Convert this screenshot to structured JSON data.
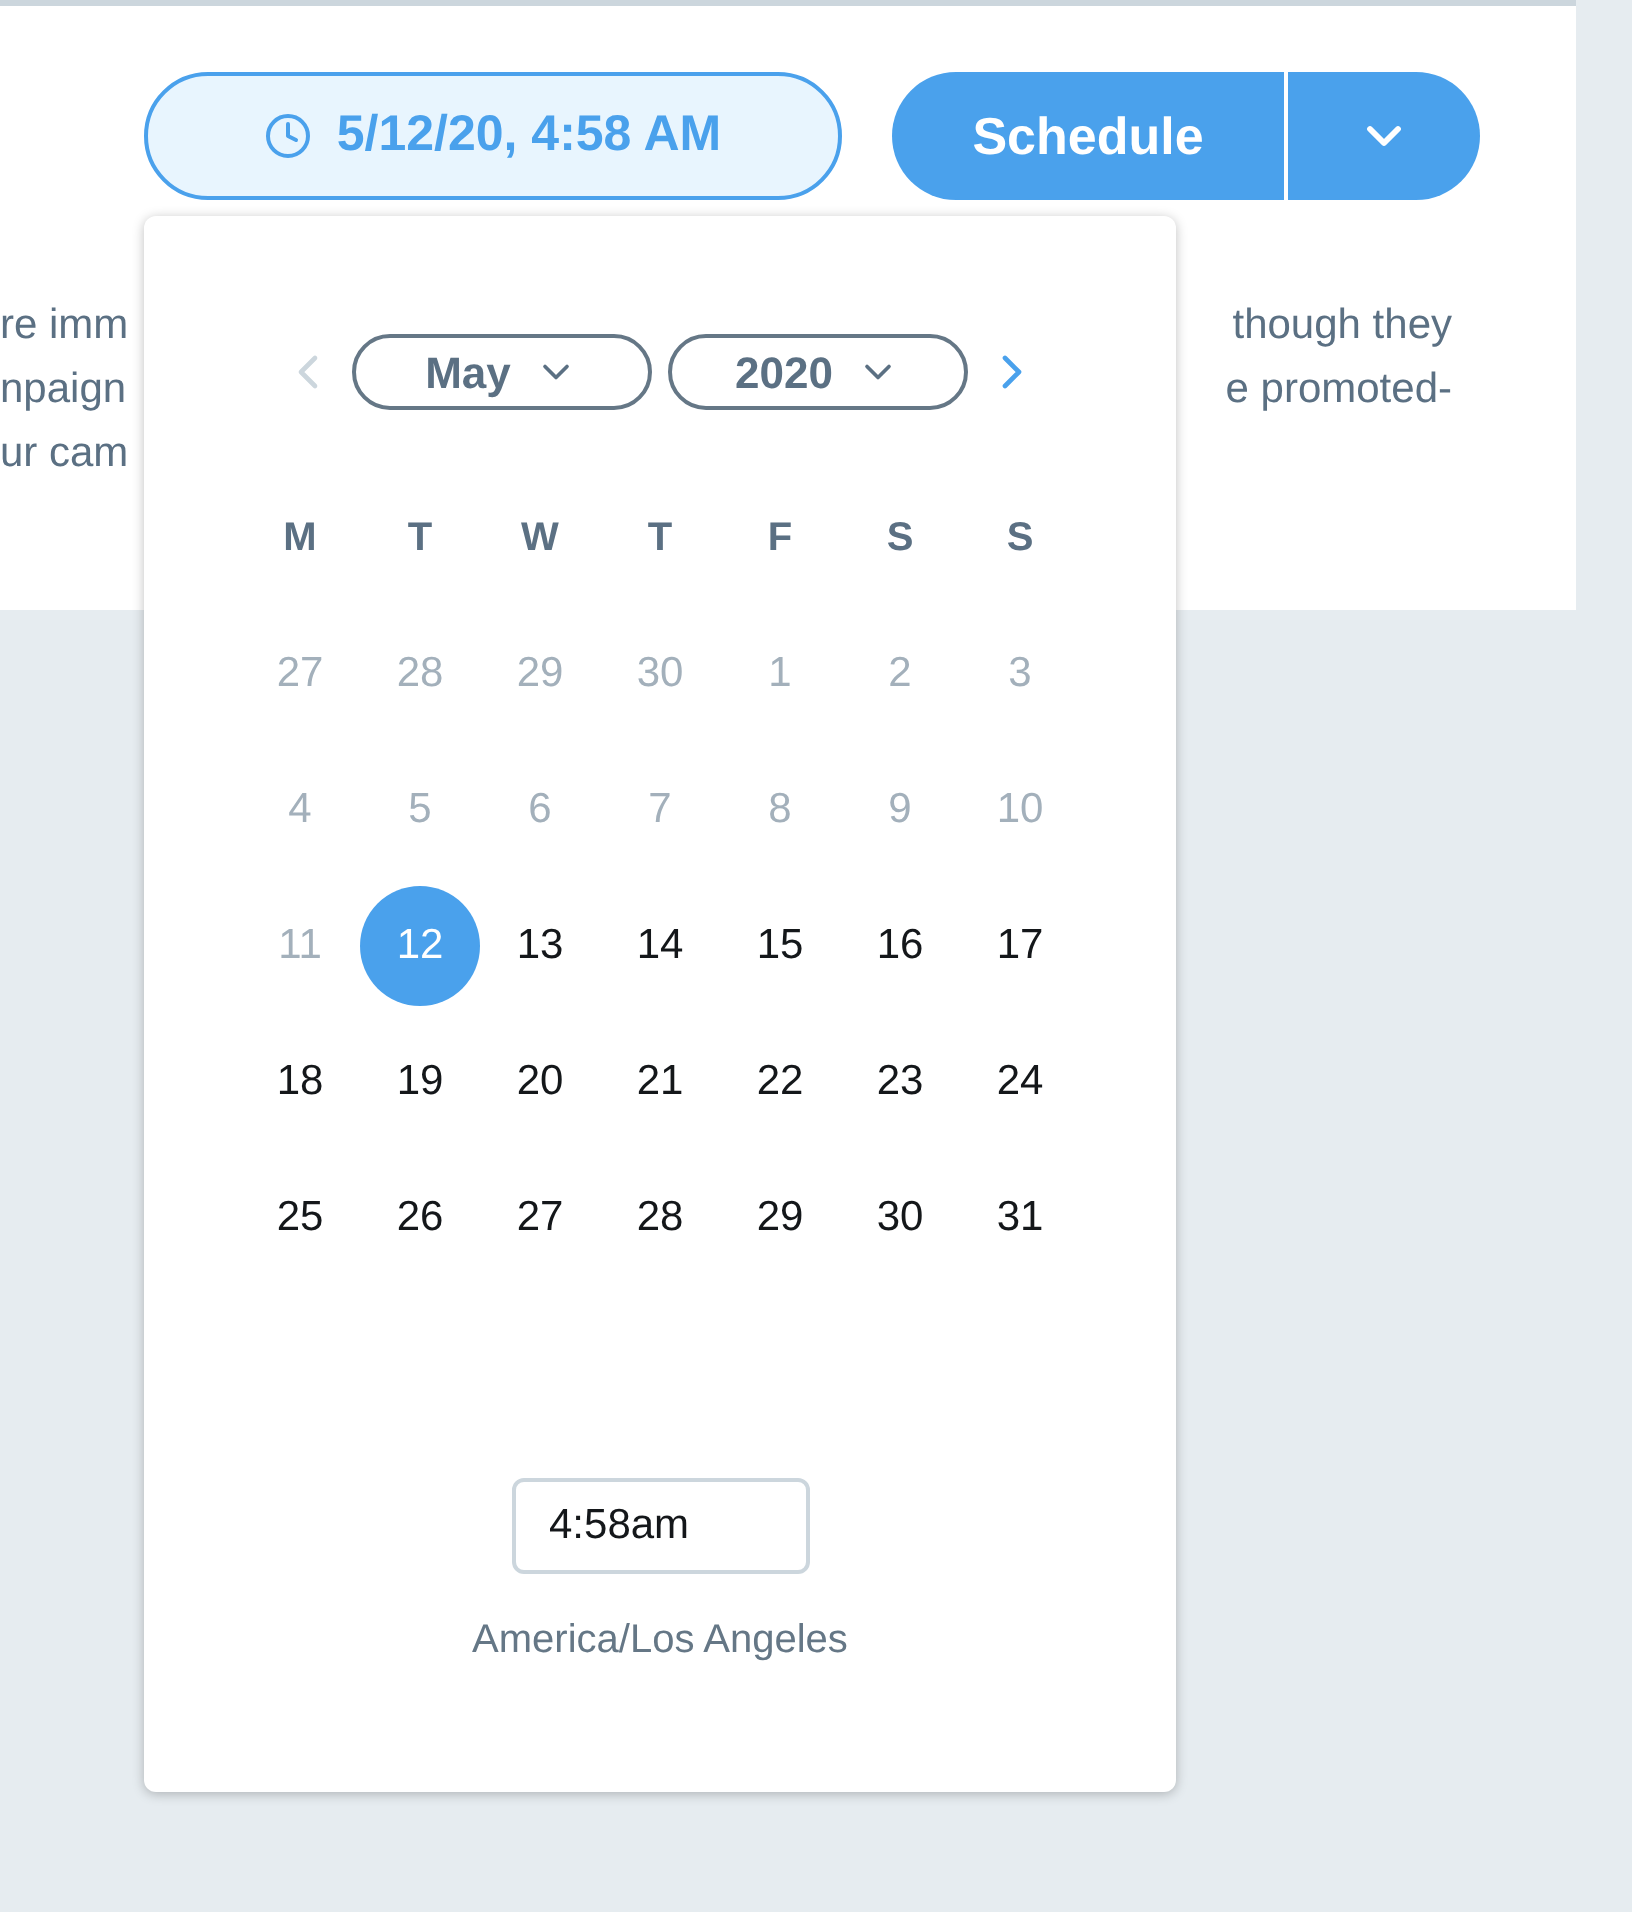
{
  "date_button": {
    "label": "5/12/20, 4:58 AM"
  },
  "schedule_button": {
    "label": "Schedule"
  },
  "description": {
    "left": [
      "re imm",
      "npaign",
      "ur cam"
    ],
    "right": [
      "though they",
      "e promoted-"
    ]
  },
  "calendar": {
    "prev_disabled": true,
    "next_disabled": false,
    "month": "May",
    "year": "2020",
    "weekdays": [
      "M",
      "T",
      "W",
      "T",
      "F",
      "S",
      "S"
    ],
    "weeks": [
      [
        {
          "label": "27",
          "outside": true,
          "selected": false
        },
        {
          "label": "28",
          "outside": true,
          "selected": false
        },
        {
          "label": "29",
          "outside": true,
          "selected": false
        },
        {
          "label": "30",
          "outside": true,
          "selected": false
        },
        {
          "label": "1",
          "outside": true,
          "selected": false
        },
        {
          "label": "2",
          "outside": true,
          "selected": false
        },
        {
          "label": "3",
          "outside": true,
          "selected": false
        }
      ],
      [
        {
          "label": "4",
          "outside": true,
          "selected": false
        },
        {
          "label": "5",
          "outside": true,
          "selected": false
        },
        {
          "label": "6",
          "outside": true,
          "selected": false
        },
        {
          "label": "7",
          "outside": true,
          "selected": false
        },
        {
          "label": "8",
          "outside": true,
          "selected": false
        },
        {
          "label": "9",
          "outside": true,
          "selected": false
        },
        {
          "label": "10",
          "outside": true,
          "selected": false
        }
      ],
      [
        {
          "label": "11",
          "outside": true,
          "selected": false
        },
        {
          "label": "12",
          "outside": false,
          "selected": true
        },
        {
          "label": "13",
          "outside": false,
          "selected": false
        },
        {
          "label": "14",
          "outside": false,
          "selected": false
        },
        {
          "label": "15",
          "outside": false,
          "selected": false
        },
        {
          "label": "16",
          "outside": false,
          "selected": false
        },
        {
          "label": "17",
          "outside": false,
          "selected": false
        }
      ],
      [
        {
          "label": "18",
          "outside": false,
          "selected": false
        },
        {
          "label": "19",
          "outside": false,
          "selected": false
        },
        {
          "label": "20",
          "outside": false,
          "selected": false
        },
        {
          "label": "21",
          "outside": false,
          "selected": false
        },
        {
          "label": "22",
          "outside": false,
          "selected": false
        },
        {
          "label": "23",
          "outside": false,
          "selected": false
        },
        {
          "label": "24",
          "outside": false,
          "selected": false
        }
      ],
      [
        {
          "label": "25",
          "outside": false,
          "selected": false
        },
        {
          "label": "26",
          "outside": false,
          "selected": false
        },
        {
          "label": "27",
          "outside": false,
          "selected": false
        },
        {
          "label": "28",
          "outside": false,
          "selected": false
        },
        {
          "label": "29",
          "outside": false,
          "selected": false
        },
        {
          "label": "30",
          "outside": false,
          "selected": false
        },
        {
          "label": "31",
          "outside": false,
          "selected": false
        }
      ]
    ],
    "time": "4:58am",
    "timezone": "America/Los Angeles"
  }
}
